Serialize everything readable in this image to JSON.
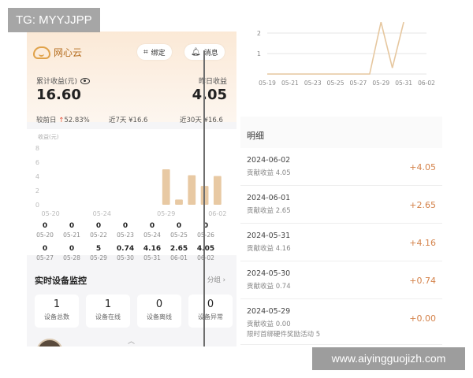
{
  "watermarks": {
    "top": "TG: MYYJJPP",
    "bottom": "www.aiyingguojizh.com"
  },
  "left": {
    "brand": "网心云",
    "bind_button": "绑定",
    "message_button": "消息",
    "cumulative_label": "累计收益(元)",
    "cumulative_value": "16.60",
    "yesterday_label": "昨日收益",
    "yesterday_value": "4.05",
    "compare_label": "较前日",
    "compare_value": "52.83%",
    "last7_label": "近7天",
    "last7_value": "¥16.6",
    "last30_label": "近30天",
    "last30_value": "¥16.6",
    "chart_unit": "收益(元)",
    "days": [
      {
        "value": "0",
        "date": "05-20"
      },
      {
        "value": "0",
        "date": "05-21"
      },
      {
        "value": "0",
        "date": "05-22"
      },
      {
        "value": "0",
        "date": "05-23"
      },
      {
        "value": "0",
        "date": "05-24"
      },
      {
        "value": "0",
        "date": "05-25"
      },
      {
        "value": "0",
        "date": "05-26"
      },
      {
        "value": "0",
        "date": "05-27"
      },
      {
        "value": "0",
        "date": "05-28"
      },
      {
        "value": "5",
        "date": "05-29"
      },
      {
        "value": "0.74",
        "date": "05-30"
      },
      {
        "value": "4.16",
        "date": "05-31"
      },
      {
        "value": "2.65",
        "date": "06-01"
      },
      {
        "value": "4.05",
        "date": "06-02"
      }
    ],
    "monitor": {
      "title": "实时设备监控",
      "group": "分组",
      "cards": [
        {
          "count": "1",
          "label": "设备总数"
        },
        {
          "count": "1",
          "label": "设备在线"
        },
        {
          "count": "0",
          "label": "设备离线"
        },
        {
          "count": "0",
          "label": "设备异常"
        }
      ]
    }
  },
  "right": {
    "detail_title": "明细",
    "entries": [
      {
        "date": "2024-06-02",
        "sub": "贡献收益 4.05",
        "amount": "+4.05"
      },
      {
        "date": "2024-06-01",
        "sub": "贡献收益 2.65",
        "amount": "+2.65"
      },
      {
        "date": "2024-05-31",
        "sub": "贡献收益 4.16",
        "amount": "+4.16"
      },
      {
        "date": "2024-05-30",
        "sub": "贡献收益 0.74",
        "amount": "+0.74"
      },
      {
        "date": "2024-05-29",
        "sub": "贡献收益 0.00",
        "sub2": "限时首绑硬件奖励活动 5",
        "amount": "+0.00"
      }
    ]
  },
  "chart_data": [
    {
      "type": "bar",
      "ylabel": "收益(元)",
      "ylim": [
        0,
        8
      ],
      "yticks": [
        0,
        2,
        4,
        6,
        8
      ],
      "categories": [
        "05-20",
        "05-21",
        "05-22",
        "05-23",
        "05-24",
        "05-25",
        "05-26",
        "05-27",
        "05-28",
        "05-29",
        "05-30",
        "05-31",
        "06-01",
        "06-02"
      ],
      "xtick_labels": [
        "05-20",
        "05-24",
        "05-29",
        "06-02"
      ],
      "values": [
        0,
        0,
        0,
        0,
        0,
        0,
        0,
        0,
        0,
        5,
        0.74,
        4.16,
        2.65,
        4.05
      ],
      "color": "#e8c9a3"
    },
    {
      "type": "line",
      "ylim": [
        0,
        2
      ],
      "yticks": [
        1,
        2
      ],
      "xtick_labels": [
        "05-19",
        "05-21",
        "05-23",
        "05-25",
        "05-27",
        "05-29",
        "05-31",
        "06-02"
      ],
      "x": [
        "05-19",
        "05-21",
        "05-23",
        "05-25",
        "05-27",
        "05-28",
        "05-29",
        "05-30",
        "05-31"
      ],
      "values": [
        0,
        0,
        0,
        0,
        0,
        0,
        2.8,
        0.3,
        2.8
      ],
      "color": "#e6c79f"
    }
  ]
}
